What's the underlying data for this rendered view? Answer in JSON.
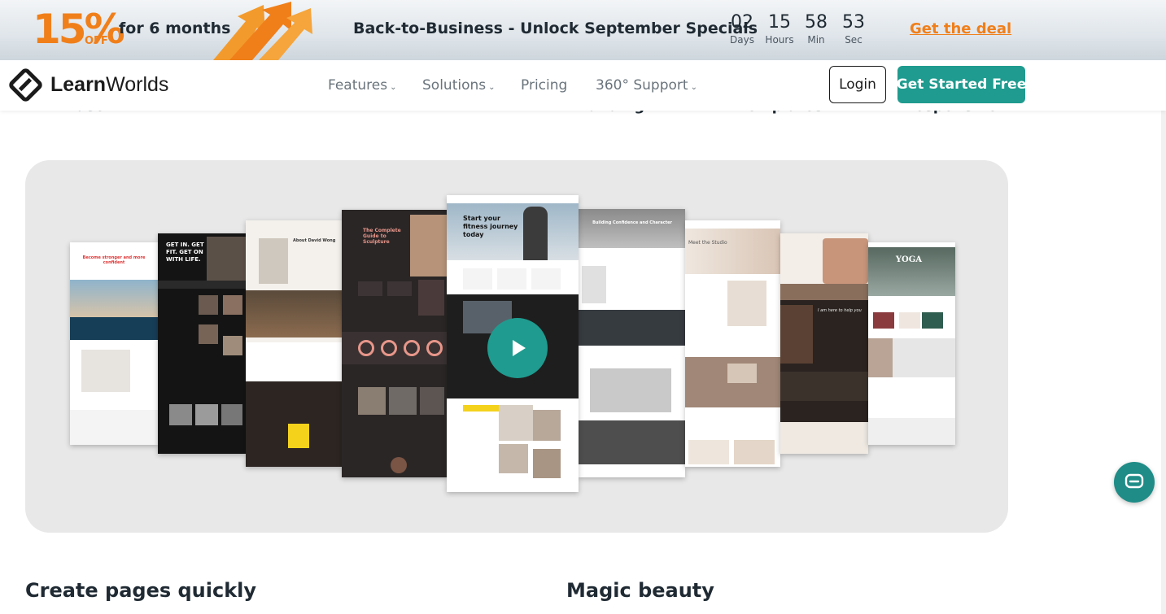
{
  "promo": {
    "percent": "15%",
    "off": "OFF",
    "duration": "for 6 months",
    "title": "Back-to-Business - Unlock September Specials",
    "countdown": [
      {
        "value": "02",
        "label": "Days"
      },
      {
        "value": "15",
        "label": "Hours"
      },
      {
        "value": "58",
        "label": "Min"
      },
      {
        "value": "53",
        "label": "Sec"
      }
    ],
    "cta": "Get the deal",
    "accent_color": "#f07f1a"
  },
  "nav": {
    "logo_strong": "Learn",
    "logo_light": "Worlds",
    "items": [
      {
        "label": "Features",
        "has_dropdown": true
      },
      {
        "label": "Solutions",
        "has_dropdown": true
      },
      {
        "label": "Pricing",
        "has_dropdown": false
      },
      {
        "label": "360° Support",
        "has_dropdown": true
      }
    ],
    "login": "Login",
    "start": "Get Started Free",
    "brand_color": "#1f9b8f"
  },
  "peek_texts": [
    "use",
    "Branding",
    "templates",
    "responsive"
  ],
  "showcase": {
    "thumb_texts": {
      "t1": "Become stronger and more confident",
      "t2": "GET IN. GET FIT. GET ON WITH LIFE.",
      "t3": "About David Wong",
      "t4": "The Complete Guide to Sculpture",
      "t5": "Start your fitness journey today",
      "t6": "Building Confidence and Character",
      "t7": "Meet the Studio",
      "t8": "I am here to help you",
      "t9": "YOGA"
    },
    "play_icon": "play-icon"
  },
  "chat_icon": "chat-icon",
  "sections": {
    "left_heading": "Create pages quickly",
    "right_heading": "Magic beauty"
  }
}
